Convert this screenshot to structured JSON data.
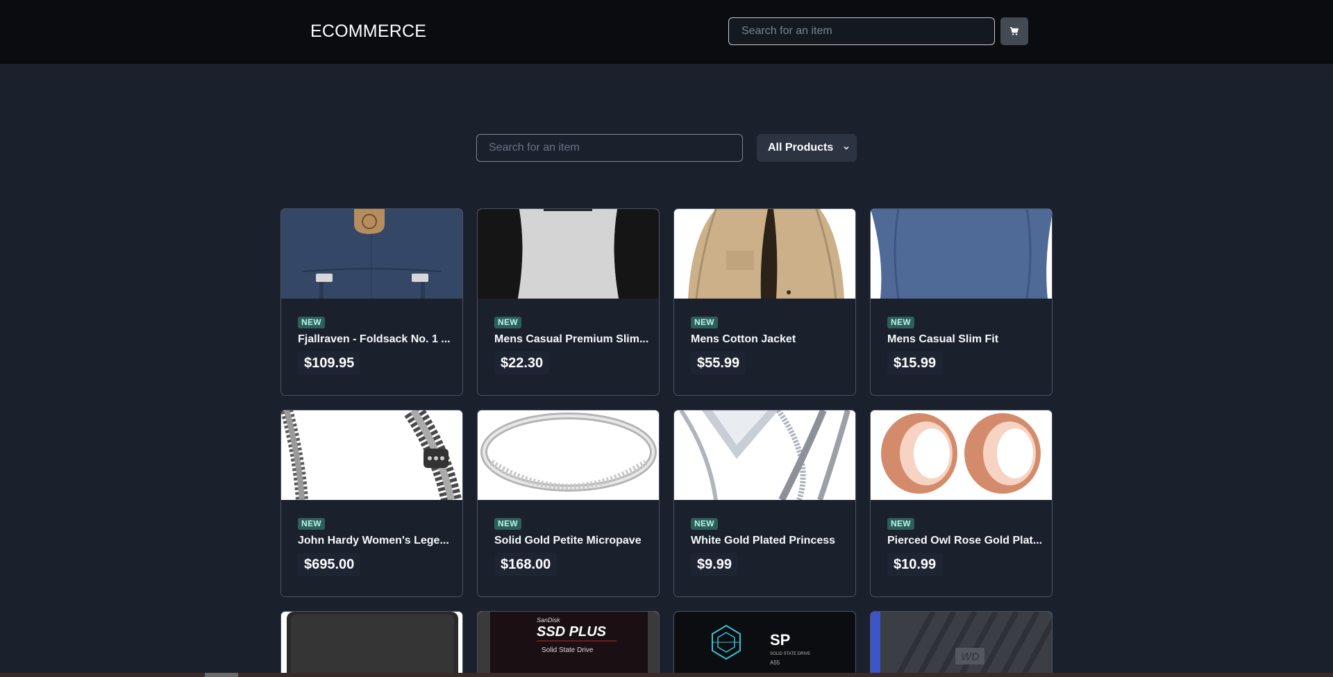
{
  "header": {
    "brand": "ECOMMERCE",
    "search_placeholder": "Search for an item",
    "cart_icon": "cart-icon"
  },
  "filters": {
    "search_placeholder": "Search for an item",
    "category_selected": "All Products",
    "chevron_icon": "chevron-down-icon"
  },
  "products": [
    {
      "badge": "NEW",
      "title": "Fjallraven - Foldsack No. 1 ...",
      "price": "$109.95",
      "image": "backpack"
    },
    {
      "badge": "NEW",
      "title": "Mens Casual Premium Slim...",
      "price": "$22.30",
      "image": "raglan-tshirt"
    },
    {
      "badge": "NEW",
      "title": "Mens Cotton Jacket",
      "price": "$55.99",
      "image": "cotton-jacket"
    },
    {
      "badge": "NEW",
      "title": "Mens Casual Slim Fit",
      "price": "$15.99",
      "image": "blue-longsleeve"
    },
    {
      "badge": "NEW",
      "title": "John Hardy Women's Lege...",
      "price": "$695.00",
      "image": "silver-chain-bracelet"
    },
    {
      "badge": "NEW",
      "title": "Solid Gold Petite Micropave",
      "price": "$168.00",
      "image": "silver-ring"
    },
    {
      "badge": "NEW",
      "title": "White Gold Plated Princess",
      "price": "$9.99",
      "image": "diamond-ring"
    },
    {
      "badge": "NEW",
      "title": "Pierced Owl Rose Gold Plat...",
      "price": "$10.99",
      "image": "rose-gold-plugs"
    }
  ],
  "partial_products": [
    {
      "image": "external-hard-drive"
    },
    {
      "image": "sandisk-ssd",
      "label_brand": "SanDisk",
      "label_title": "SSD PLUS",
      "label_sub": "Solid State Drive"
    },
    {
      "image": "silicon-power-ssd",
      "label_brand": "SP",
      "label_sub": "SOLID STATE DRIVE",
      "label_model": "A55"
    },
    {
      "image": "wd-drive",
      "label_brand": "WD"
    }
  ]
}
